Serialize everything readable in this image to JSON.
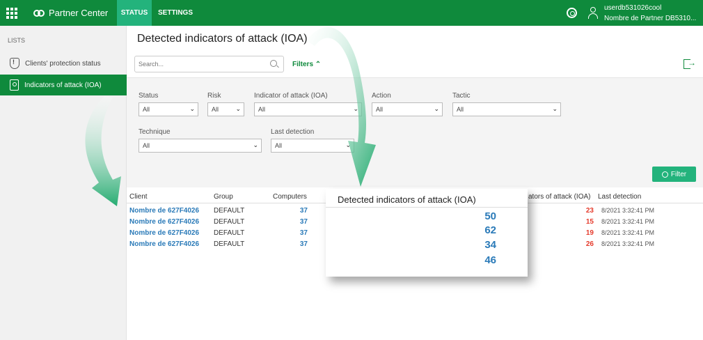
{
  "topbar": {
    "brand": "Partner Center",
    "tabs": [
      {
        "label": "STATUS"
      },
      {
        "label": "SETTINGS"
      }
    ],
    "user": {
      "name": "userdb531026cool",
      "partner": "Nombre de Partner DB5310..."
    }
  },
  "sidebar": {
    "title": "LISTS",
    "items": [
      {
        "label": "Clients' protection status",
        "icon": "shield-icon"
      },
      {
        "label": "Indicators of attack (IOA)",
        "icon": "badge-icon"
      }
    ]
  },
  "page": {
    "title": "Detected indicators of attack (IOA)"
  },
  "toolbar": {
    "search_placeholder": "Search...",
    "filters_label": "Filters"
  },
  "filters": {
    "status": {
      "label": "Status",
      "value": "All"
    },
    "risk": {
      "label": "Risk",
      "value": "All"
    },
    "ioa": {
      "label": "Indicator of attack (IOA)",
      "value": "All"
    },
    "action": {
      "label": "Action",
      "value": "All"
    },
    "tactic": {
      "label": "Tactic",
      "value": "All"
    },
    "technique": {
      "label": "Technique",
      "value": "All"
    },
    "last_detection": {
      "label": "Last detection",
      "value": "All"
    },
    "button": "Filter"
  },
  "table": {
    "headers": {
      "client": "Client",
      "group": "Group",
      "computers": "Computers",
      "ioa": "ators of attack (IOA)",
      "last_detection": "Last detection"
    },
    "rows": [
      {
        "client": "Nombre de 627F4026",
        "group": "DEFAULT",
        "computers": "37",
        "ioa": "23",
        "date": "8/2021 3:32:41 PM"
      },
      {
        "client": "Nombre de 627F4026",
        "group": "DEFAULT",
        "computers": "37",
        "ioa": "15",
        "date": "8/2021 3:32:41 PM"
      },
      {
        "client": "Nombre de 627F4026",
        "group": "DEFAULT",
        "computers": "37",
        "ioa": "19",
        "date": "8/2021 3:32:41 PM"
      },
      {
        "client": "Nombre de 627F4026",
        "group": "DEFAULT",
        "computers": "37",
        "ioa": "26",
        "date": "8/2021 3:32:41 PM"
      }
    ]
  },
  "callout": {
    "title": "Detected indicators of attack (IOA)",
    "values": [
      "50",
      "62",
      "34",
      "46"
    ]
  },
  "colors": {
    "brand_green": "#0f8a3c",
    "accent_green": "#23b37c",
    "link_blue": "#2a7ab8",
    "alert_red": "#e53b2c"
  }
}
